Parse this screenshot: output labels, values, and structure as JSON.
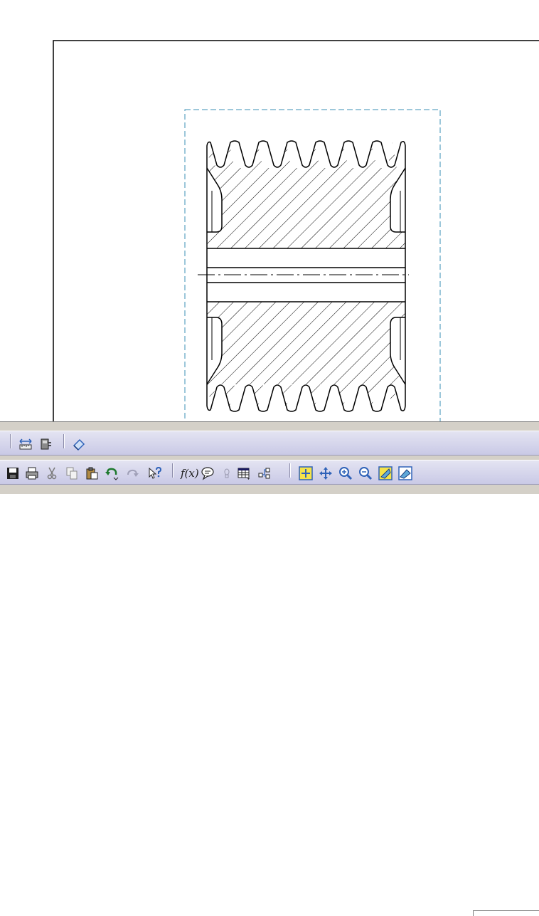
{
  "drawing": {
    "sheet_name": "drawing-sheet",
    "view_name": "pulley-section-view"
  },
  "toolbar_row_1": [
    {
      "id": "measure-between-icon"
    },
    {
      "id": "measure-item-icon"
    },
    {
      "id": "apply-material-icon"
    }
  ],
  "toolbar_row_2": [
    {
      "id": "save-icon"
    },
    {
      "id": "print-icon"
    },
    {
      "id": "cut-icon"
    },
    {
      "id": "copy-icon"
    },
    {
      "id": "paste-icon"
    },
    {
      "id": "undo-icon"
    },
    {
      "id": "redo-icon"
    },
    {
      "id": "whats-this-icon"
    },
    {
      "id": "formula-icon",
      "label": "f(x)"
    },
    {
      "id": "comment-icon"
    },
    {
      "id": "design-table-icon"
    },
    {
      "id": "catalog-icon"
    },
    {
      "id": "fit-all-in-icon"
    },
    {
      "id": "pan-icon"
    },
    {
      "id": "zoom-in-icon"
    },
    {
      "id": "zoom-out-icon"
    },
    {
      "id": "normal-view-icon"
    },
    {
      "id": "hide-show-icon"
    }
  ],
  "colors": {
    "frame_dash": "#3a8fb5",
    "toolbar": "#d4d4ec",
    "icon_accent": "#2f62b8"
  }
}
